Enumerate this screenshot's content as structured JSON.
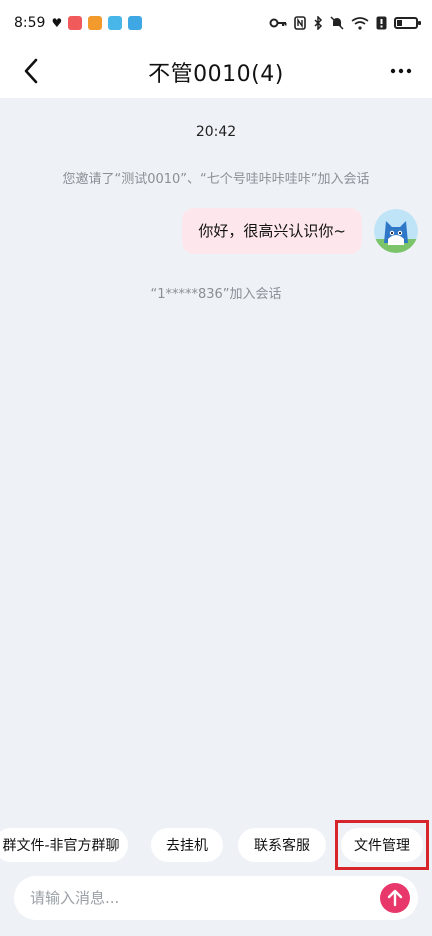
{
  "status_bar": {
    "time": "8:59",
    "icons": [
      "heart-sync-icon",
      "app-red-icon",
      "app-orange-icon",
      "app-blue-icon",
      "app-blue2-icon",
      "key-icon",
      "nfc-icon",
      "bluetooth-icon",
      "mute-icon",
      "wifi-icon",
      "alert-icon",
      "battery-icon"
    ]
  },
  "header": {
    "title": "不管0010(4)",
    "back_icon": "chevron-left-icon",
    "more_icon": "more-dots-icon"
  },
  "chat": {
    "timestamp": "20:42",
    "system_invite": "您邀请了“测试0010”、“七个号哇咔咔哇咔”加入会话",
    "outgoing_message": "你好，很高兴认识你~",
    "system_join": "“1*****836”加入会话"
  },
  "quick_actions": [
    {
      "label": "群文件-非官方群聊"
    },
    {
      "label": "去挂机"
    },
    {
      "label": "联系客服"
    },
    {
      "label": "文件管理"
    }
  ],
  "input": {
    "placeholder": "请输入消息...",
    "value": ""
  },
  "colors": {
    "accent": "#e8386b",
    "bubble": "#fde7ec",
    "highlight": "#d7262b",
    "background": "#eef2f6"
  }
}
